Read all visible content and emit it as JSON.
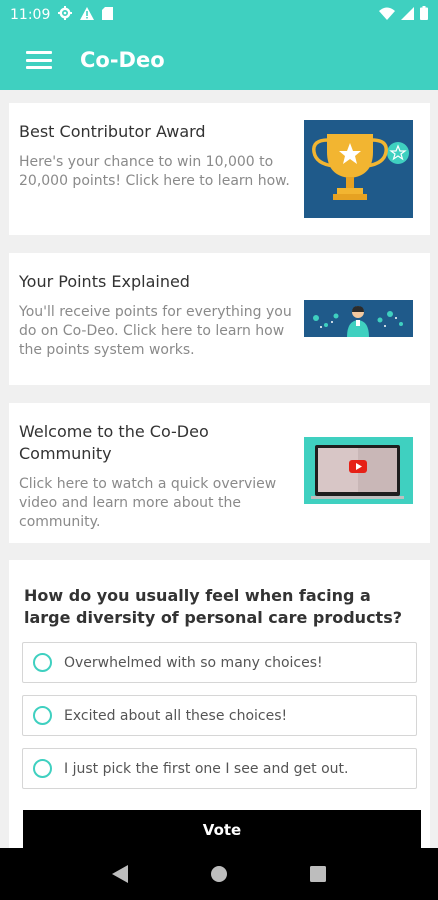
{
  "status": {
    "time": "11:09"
  },
  "app": {
    "title": "Co-Deo"
  },
  "cards": [
    {
      "title": "Best Contributor Award",
      "desc": "Here's your chance to win 10,000 to 20,000 points! Click here to learn how."
    },
    {
      "title": "Your Points Explained",
      "desc": "You'll receive points for everything you do on Co-Deo. Click here to learn how the points system works."
    },
    {
      "title": "Welcome to the Co-Deo Community",
      "desc": "Click here to watch a quick overview video and learn more about the community."
    }
  ],
  "poll": {
    "question": "How do you usually feel when facing a large diversity of personal care products?",
    "options": [
      {
        "label": "Overwhelmed with so many choices!"
      },
      {
        "label": "Excited about all these choices!"
      },
      {
        "label": "I just pick the first one I see and get out."
      }
    ],
    "vote_label": "Vote"
  },
  "colors": {
    "accent": "#3fd0c0",
    "background": "#f0f0f0"
  }
}
